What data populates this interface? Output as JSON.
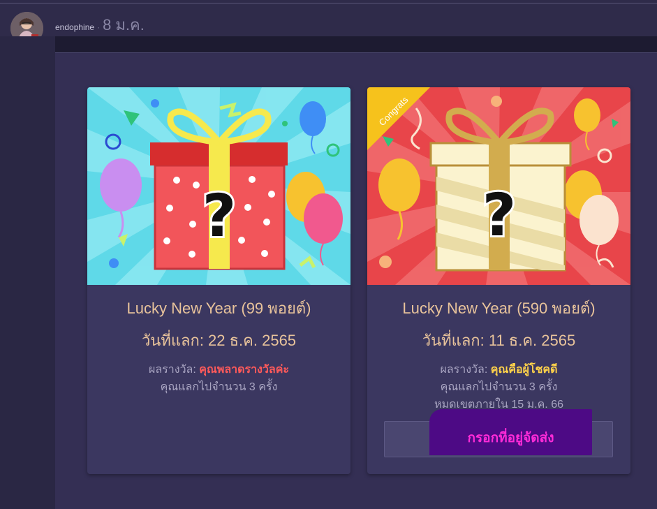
{
  "post": {
    "username": "endophine",
    "separator": "·",
    "date": "8 ม.ค."
  },
  "cards": [
    {
      "title": "Lucky New Year (99 พอยต์)",
      "date": "วันที่แลก: 22 ธ.ค. 2565",
      "prize_label": "ผลรางวัล: ",
      "prize_value": "คุณพลาดรางวัลค่ะ",
      "count_text": "คุณแลกไปจำนวน 3 ครั้ง"
    },
    {
      "ribbon": "Congrats",
      "title": "Lucky New Year (590 พอยต์)",
      "date": "วันที่แลก: 11 ธ.ค. 2565",
      "prize_label": "ผลรางวัล: ",
      "prize_value": "คุณคือผู้โชคดี",
      "count_text": "คุณแลกไปจำนวน 3 ครั้ง",
      "expiry_text": "หมดเขตภายใน 15 ม.ค. 66",
      "button_label": "กรอกที่อยู่จัดส่ง"
    }
  ],
  "colors": {
    "card1_background": "#5fd9e8",
    "card2_background": "#e8454a",
    "miss_color": "#ff5a5a",
    "win_color": "#ffd24a",
    "button_text": "#ff2bd8"
  }
}
